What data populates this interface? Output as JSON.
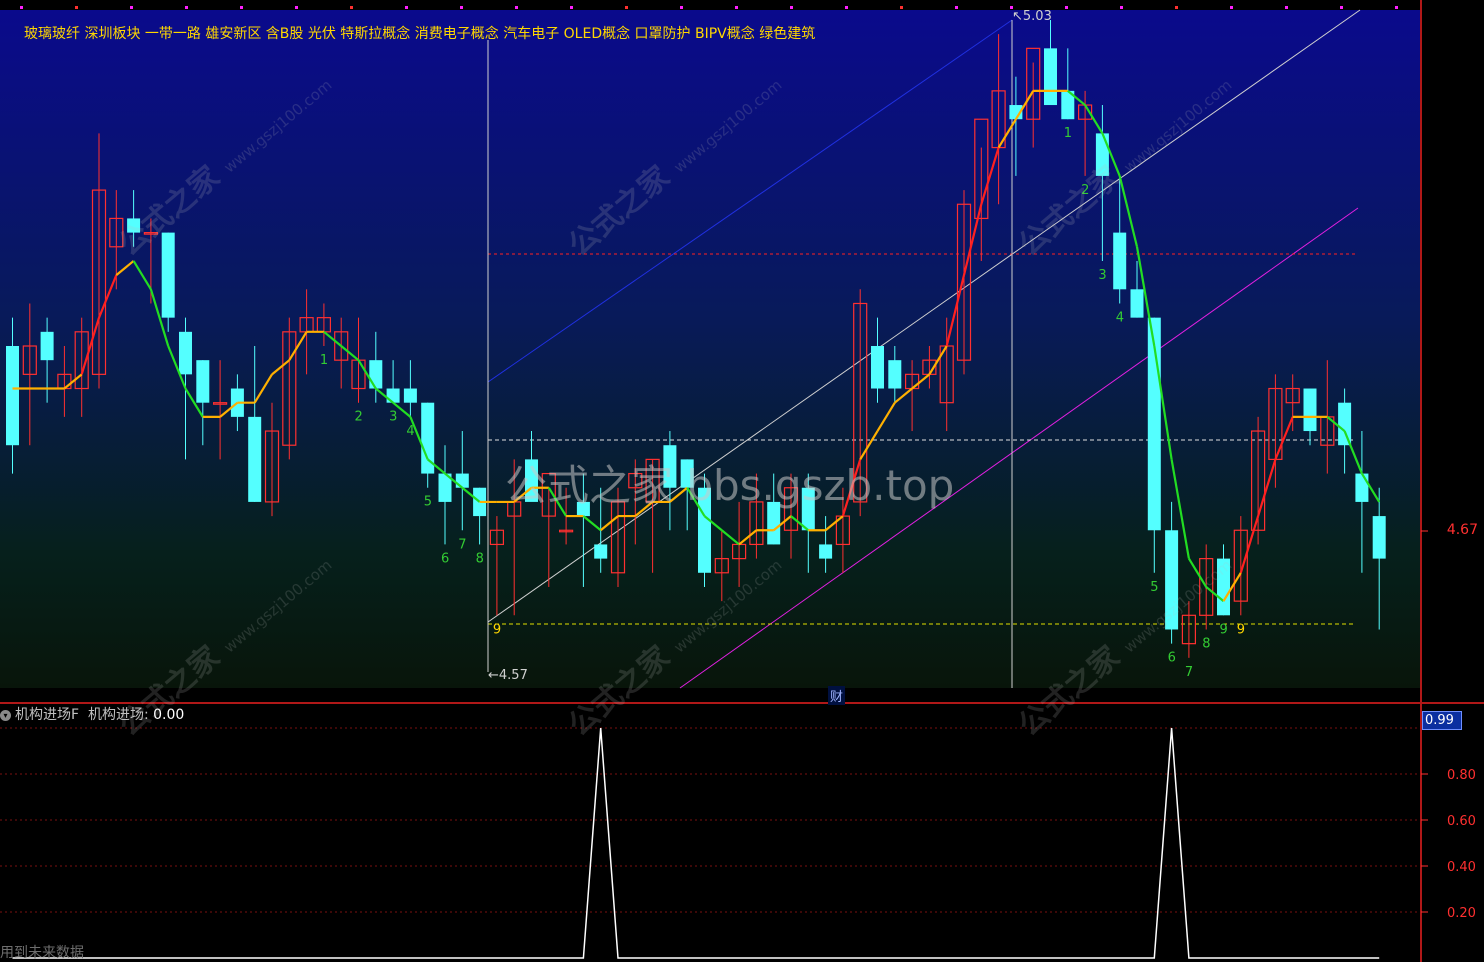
{
  "sectors_text": "玻璃玻纤 深圳板块 一带一路 雄安新区 含B股 光伏 特斯拉概念 消费电子概念 汽车电子 OLED概念 口罩防护 BIPV概念 绿色建筑",
  "indicator": {
    "name": "机构进场F",
    "line_name": "机构进场:",
    "value": "0.00",
    "current_value": "0.99"
  },
  "footer_text": "用到未来数据",
  "price_label": "4.67",
  "caption": "公式之家 bbs.gszb.top",
  "watermark": {
    "main": "公式之家",
    "url": "www.gszj100.com"
  },
  "special_marker": "财",
  "high_label": "5.03",
  "low_label": "4.57",
  "colors": {
    "up_candle": "#ff3030",
    "down_candle": "#54ffff",
    "ma_rising": "#ff2020",
    "ma_mid": "#ffb000",
    "ma_falling": "#22dd22",
    "trend_blue": "#2030e0",
    "trend_magenta": "#e020e0",
    "trend_white": "#d0d0d0",
    "count_green": "#33cc33",
    "count_yellow": "#ffd700"
  },
  "chart_data": [
    {
      "type": "candlestick",
      "high": 5.03,
      "low": 4.57,
      "right_axis_labels": [
        "4.67"
      ],
      "candles": [
        {
          "o": 4.8,
          "h": 4.82,
          "l": 4.71,
          "c": 4.73
        },
        {
          "o": 4.78,
          "h": 4.83,
          "l": 4.73,
          "c": 4.8
        },
        {
          "o": 4.81,
          "h": 4.82,
          "l": 4.76,
          "c": 4.79
        },
        {
          "o": 4.77,
          "h": 4.8,
          "l": 4.75,
          "c": 4.78
        },
        {
          "o": 4.77,
          "h": 4.82,
          "l": 4.75,
          "c": 4.81
        },
        {
          "o": 4.78,
          "h": 4.95,
          "l": 4.77,
          "c": 4.91
        },
        {
          "o": 4.87,
          "h": 4.91,
          "l": 4.84,
          "c": 4.89
        },
        {
          "o": 4.89,
          "h": 4.91,
          "l": 4.87,
          "c": 4.88
        },
        {
          "o": 4.88,
          "h": 4.89,
          "l": 4.83,
          "c": 4.88
        },
        {
          "o": 4.88,
          "h": 4.88,
          "l": 4.81,
          "c": 4.82
        },
        {
          "o": 4.81,
          "h": 4.82,
          "l": 4.72,
          "c": 4.78
        },
        {
          "o": 4.79,
          "h": 4.79,
          "l": 4.73,
          "c": 4.76
        },
        {
          "o": 4.76,
          "h": 4.79,
          "l": 4.72,
          "c": 4.76
        },
        {
          "o": 4.77,
          "h": 4.78,
          "l": 4.74,
          "c": 4.75
        },
        {
          "o": 4.75,
          "h": 4.8,
          "l": 4.69,
          "c": 4.69
        },
        {
          "o": 4.69,
          "h": 4.76,
          "l": 4.68,
          "c": 4.74
        },
        {
          "o": 4.73,
          "h": 4.82,
          "l": 4.72,
          "c": 4.81
        },
        {
          "o": 4.81,
          "h": 4.84,
          "l": 4.78,
          "c": 4.82
        },
        {
          "o": 4.81,
          "h": 4.83,
          "l": 4.8,
          "c": 4.82
        },
        {
          "o": 4.79,
          "h": 4.82,
          "l": 4.77,
          "c": 4.81
        },
        {
          "o": 4.77,
          "h": 4.82,
          "l": 4.76,
          "c": 4.79
        },
        {
          "o": 4.79,
          "h": 4.81,
          "l": 4.76,
          "c": 4.77
        },
        {
          "o": 4.77,
          "h": 4.79,
          "l": 4.76,
          "c": 4.76
        },
        {
          "o": 4.77,
          "h": 4.79,
          "l": 4.75,
          "c": 4.76
        },
        {
          "o": 4.76,
          "h": 4.76,
          "l": 4.7,
          "c": 4.71
        },
        {
          "o": 4.71,
          "h": 4.73,
          "l": 4.66,
          "c": 4.69
        },
        {
          "o": 4.71,
          "h": 4.74,
          "l": 4.67,
          "c": 4.7
        },
        {
          "o": 4.7,
          "h": 4.7,
          "l": 4.66,
          "c": 4.68
        },
        {
          "o": 4.66,
          "h": 4.68,
          "l": 4.61,
          "c": 4.67
        },
        {
          "o": 4.68,
          "h": 4.72,
          "l": 4.61,
          "c": 4.69
        },
        {
          "o": 4.72,
          "h": 4.74,
          "l": 4.7,
          "c": 4.69
        },
        {
          "o": 4.68,
          "h": 4.7,
          "l": 4.63,
          "c": 4.71
        },
        {
          "o": 4.67,
          "h": 4.7,
          "l": 4.66,
          "c": 4.67
        },
        {
          "o": 4.69,
          "h": 4.71,
          "l": 4.63,
          "c": 4.68
        },
        {
          "o": 4.66,
          "h": 4.7,
          "l": 4.64,
          "c": 4.65
        },
        {
          "o": 4.64,
          "h": 4.7,
          "l": 4.63,
          "c": 4.69
        },
        {
          "o": 4.7,
          "h": 4.72,
          "l": 4.66,
          "c": 4.71
        },
        {
          "o": 4.69,
          "h": 4.72,
          "l": 4.64,
          "c": 4.72
        },
        {
          "o": 4.73,
          "h": 4.74,
          "l": 4.67,
          "c": 4.7
        },
        {
          "o": 4.72,
          "h": 4.72,
          "l": 4.67,
          "c": 4.7
        },
        {
          "o": 4.7,
          "h": 4.71,
          "l": 4.63,
          "c": 4.64
        },
        {
          "o": 4.64,
          "h": 4.67,
          "l": 4.62,
          "c": 4.65
        },
        {
          "o": 4.65,
          "h": 4.69,
          "l": 4.63,
          "c": 4.66
        },
        {
          "o": 4.66,
          "h": 4.71,
          "l": 4.65,
          "c": 4.69
        },
        {
          "o": 4.69,
          "h": 4.71,
          "l": 4.66,
          "c": 4.66
        },
        {
          "o": 4.67,
          "h": 4.71,
          "l": 4.65,
          "c": 4.7
        },
        {
          "o": 4.7,
          "h": 4.71,
          "l": 4.64,
          "c": 4.67
        },
        {
          "o": 4.66,
          "h": 4.68,
          "l": 4.64,
          "c": 4.65
        },
        {
          "o": 4.66,
          "h": 4.7,
          "l": 4.64,
          "c": 4.68
        },
        {
          "o": 4.69,
          "h": 4.84,
          "l": 4.68,
          "c": 4.83
        },
        {
          "o": 4.8,
          "h": 4.82,
          "l": 4.76,
          "c": 4.77
        },
        {
          "o": 4.79,
          "h": 4.8,
          "l": 4.76,
          "c": 4.77
        },
        {
          "o": 4.77,
          "h": 4.79,
          "l": 4.74,
          "c": 4.78
        },
        {
          "o": 4.78,
          "h": 4.8,
          "l": 4.77,
          "c": 4.79
        },
        {
          "o": 4.76,
          "h": 4.82,
          "l": 4.74,
          "c": 4.8
        },
        {
          "o": 4.79,
          "h": 4.91,
          "l": 4.78,
          "c": 4.9
        },
        {
          "o": 4.89,
          "h": 4.94,
          "l": 4.86,
          "c": 4.96
        },
        {
          "o": 4.94,
          "h": 5.02,
          "l": 4.9,
          "c": 4.98
        },
        {
          "o": 4.97,
          "h": 4.99,
          "l": 4.92,
          "c": 4.96
        },
        {
          "o": 4.96,
          "h": 5.0,
          "l": 4.94,
          "c": 5.01
        },
        {
          "o": 5.01,
          "h": 5.03,
          "l": 4.97,
          "c": 4.97
        },
        {
          "o": 4.98,
          "h": 5.01,
          "l": 4.96,
          "c": 4.96
        },
        {
          "o": 4.96,
          "h": 4.98,
          "l": 4.92,
          "c": 4.97
        },
        {
          "o": 4.95,
          "h": 4.97,
          "l": 4.86,
          "c": 4.92
        },
        {
          "o": 4.88,
          "h": 4.92,
          "l": 4.83,
          "c": 4.84
        },
        {
          "o": 4.84,
          "h": 4.86,
          "l": 4.82,
          "c": 4.82
        },
        {
          "o": 4.82,
          "h": 4.82,
          "l": 4.64,
          "c": 4.67
        },
        {
          "o": 4.67,
          "h": 4.69,
          "l": 4.59,
          "c": 4.6
        },
        {
          "o": 4.59,
          "h": 4.62,
          "l": 4.58,
          "c": 4.61
        },
        {
          "o": 4.61,
          "h": 4.66,
          "l": 4.6,
          "c": 4.65
        },
        {
          "o": 4.65,
          "h": 4.66,
          "l": 4.61,
          "c": 4.61
        },
        {
          "o": 4.62,
          "h": 4.68,
          "l": 4.61,
          "c": 4.67
        },
        {
          "o": 4.67,
          "h": 4.75,
          "l": 4.66,
          "c": 4.74
        },
        {
          "o": 4.72,
          "h": 4.78,
          "l": 4.7,
          "c": 4.77
        },
        {
          "o": 4.76,
          "h": 4.78,
          "l": 4.74,
          "c": 4.77
        },
        {
          "o": 4.77,
          "h": 4.77,
          "l": 4.73,
          "c": 4.74
        },
        {
          "o": 4.73,
          "h": 4.79,
          "l": 4.71,
          "c": 4.75
        },
        {
          "o": 4.76,
          "h": 4.77,
          "l": 4.71,
          "c": 4.73
        },
        {
          "o": 4.71,
          "h": 4.74,
          "l": 4.64,
          "c": 4.69
        },
        {
          "o": 4.68,
          "h": 4.7,
          "l": 4.6,
          "c": 4.65
        }
      ],
      "ma": [
        4.77,
        4.77,
        4.77,
        4.77,
        4.78,
        4.82,
        4.85,
        4.86,
        4.84,
        4.8,
        4.77,
        4.75,
        4.75,
        4.76,
        4.76,
        4.78,
        4.79,
        4.81,
        4.81,
        4.8,
        4.79,
        4.77,
        4.76,
        4.75,
        4.72,
        4.71,
        4.7,
        4.69,
        4.69,
        4.69,
        4.7,
        4.7,
        4.68,
        4.68,
        4.67,
        4.68,
        4.68,
        4.69,
        4.69,
        4.7,
        4.68,
        4.67,
        4.66,
        4.67,
        4.67,
        4.68,
        4.67,
        4.67,
        4.68,
        4.72,
        4.74,
        4.76,
        4.77,
        4.78,
        4.8,
        4.85,
        4.9,
        4.94,
        4.96,
        4.98,
        4.98,
        4.98,
        4.97,
        4.95,
        4.92,
        4.87,
        4.8,
        4.72,
        4.65,
        4.63,
        4.62,
        4.64,
        4.68,
        4.72,
        4.75,
        4.75,
        4.75,
        4.74,
        4.71,
        4.69
      ],
      "count_labels": [
        {
          "i": 18,
          "text": "1",
          "color": "green"
        },
        {
          "i": 20,
          "text": "2",
          "color": "green"
        },
        {
          "i": 22,
          "text": "3",
          "color": "green"
        },
        {
          "i": 23,
          "text": "4",
          "color": "green"
        },
        {
          "i": 24,
          "text": "5",
          "color": "green"
        },
        {
          "i": 25,
          "text": "6",
          "color": "green"
        },
        {
          "i": 26,
          "text": "7",
          "color": "green"
        },
        {
          "i": 27,
          "text": "8",
          "color": "green"
        },
        {
          "i": 28,
          "text": "9",
          "color": "yellow"
        },
        {
          "i": 61,
          "text": "1",
          "color": "green"
        },
        {
          "i": 62,
          "text": "2",
          "color": "green"
        },
        {
          "i": 63,
          "text": "3",
          "color": "green"
        },
        {
          "i": 64,
          "text": "4",
          "color": "green"
        },
        {
          "i": 66,
          "text": "5",
          "color": "green"
        },
        {
          "i": 67,
          "text": "6",
          "color": "green"
        },
        {
          "i": 68,
          "text": "7",
          "color": "green"
        },
        {
          "i": 69,
          "text": "8",
          "color": "green"
        },
        {
          "i": 70,
          "text": "9",
          "color": "green"
        },
        {
          "i": 71,
          "text": "9",
          "color": "yellow"
        }
      ]
    },
    {
      "type": "line",
      "name": "机构进场",
      "yticks": [
        "0.20",
        "0.40",
        "0.60",
        "0.80"
      ],
      "ylim": [
        0,
        1
      ],
      "values": [
        0,
        0,
        0,
        0,
        0,
        0,
        0,
        0,
        0,
        0,
        0,
        0,
        0,
        0,
        0,
        0,
        0,
        0,
        0,
        0,
        0,
        0,
        0,
        0,
        0,
        0,
        0,
        0,
        0,
        0,
        0,
        0,
        0,
        0,
        1,
        0,
        0,
        0,
        0,
        0,
        0,
        0,
        0,
        0,
        0,
        0,
        0,
        0,
        0,
        0,
        0,
        0,
        0,
        0,
        0,
        0,
        0,
        0,
        0,
        0,
        0,
        0,
        0,
        0,
        0,
        0,
        0,
        1,
        0,
        0,
        0,
        0,
        0,
        0,
        0,
        0,
        0,
        0,
        0,
        0
      ]
    }
  ]
}
